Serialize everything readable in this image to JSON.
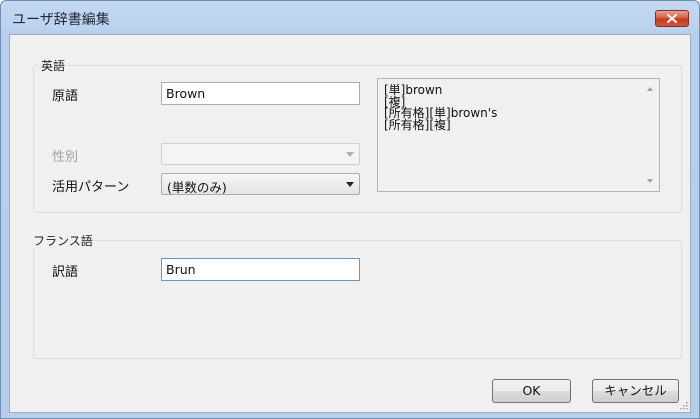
{
  "window": {
    "title": "ユーザ辞書編集",
    "close_icon": "close-x-icon"
  },
  "english_group": {
    "label": "英語",
    "original_label": "原語",
    "original_value": "Brown",
    "gender_label": "性別",
    "gender_value": "",
    "conjugation_label": "活用パターン",
    "conjugation_value": "(単数のみ)",
    "preview_lines": [
      "[単]brown",
      "[複]",
      "[所有格][単]brown's",
      "[所有格][複]"
    ]
  },
  "french_group": {
    "label": "フランス語",
    "translation_label": "訳語",
    "translation_value": "Brun"
  },
  "buttons": {
    "ok": "OK",
    "cancel": "キャンセル"
  }
}
